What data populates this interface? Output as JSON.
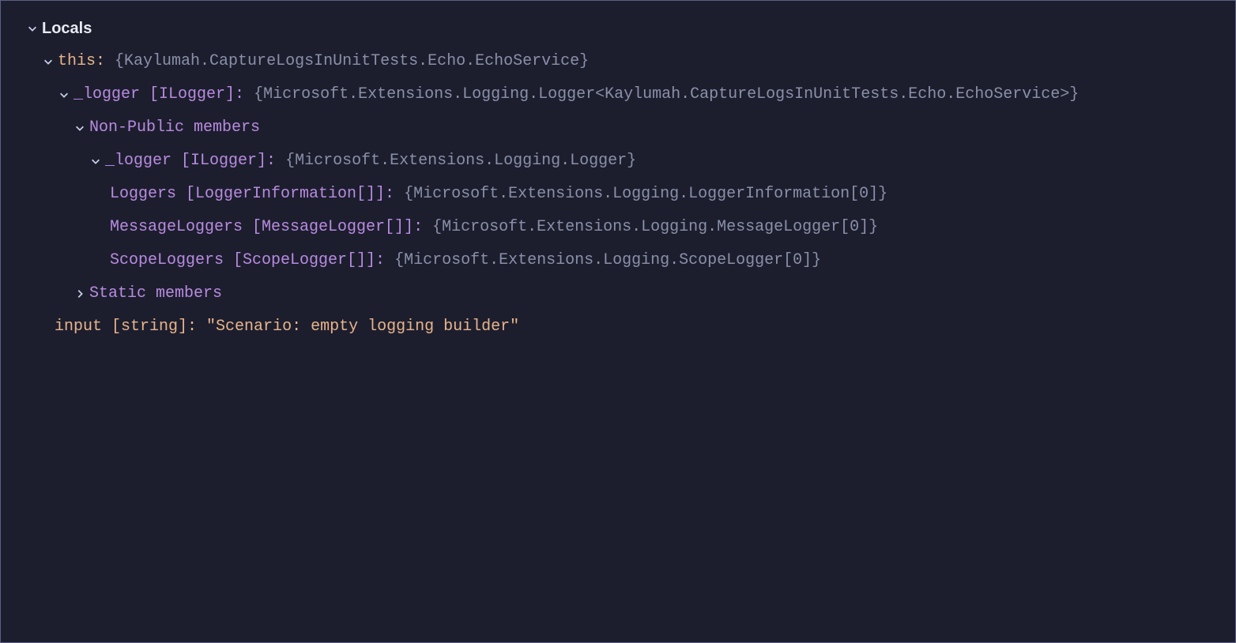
{
  "header": {
    "title": "Locals"
  },
  "rows": [
    {
      "indent": 1,
      "chevron": "down",
      "name": "this:",
      "nameColor": "orange",
      "value": "{Kaylumah.CaptureLogsInUnitTests.Echo.EchoService}",
      "valueColor": "gray"
    },
    {
      "indent": 2,
      "chevron": "down",
      "name": "_logger [ILogger]:",
      "nameColor": "purple",
      "value": "{Microsoft.Extensions.Logging.Logger<Kaylumah.CaptureLogsInUnitTests.Echo.EchoService>}",
      "valueColor": "gray"
    },
    {
      "indent": 3,
      "chevron": "down",
      "name": "Non-Public members",
      "nameColor": "purple",
      "value": "",
      "valueColor": "gray"
    },
    {
      "indent": 4,
      "chevron": "down",
      "name": "_logger [ILogger]:",
      "nameColor": "purple",
      "value": "{Microsoft.Extensions.Logging.Logger}",
      "valueColor": "gray"
    },
    {
      "indent": 5,
      "chevron": "none",
      "name": "Loggers [LoggerInformation[]]:",
      "nameColor": "purple",
      "value": "{Microsoft.Extensions.Logging.LoggerInformation[0]}",
      "valueColor": "gray"
    },
    {
      "indent": 5,
      "chevron": "none",
      "name": "MessageLoggers [MessageLogger[]]:",
      "nameColor": "purple",
      "value": "{Microsoft.Extensions.Logging.MessageLogger[0]}",
      "valueColor": "gray"
    },
    {
      "indent": 5,
      "chevron": "none",
      "name": "ScopeLoggers [ScopeLogger[]]:",
      "nameColor": "purple",
      "value": "{Microsoft.Extensions.Logging.ScopeLogger[0]}",
      "valueColor": "gray"
    },
    {
      "indent": 3,
      "chevron": "right",
      "name": "Static members",
      "nameColor": "purple",
      "value": "",
      "valueColor": "gray"
    },
    {
      "indent": 2,
      "chevron": "none",
      "name": "input [string]:",
      "nameColor": "orange",
      "value": "\"Scenario: empty logging builder\"",
      "valueColor": "orange"
    }
  ]
}
